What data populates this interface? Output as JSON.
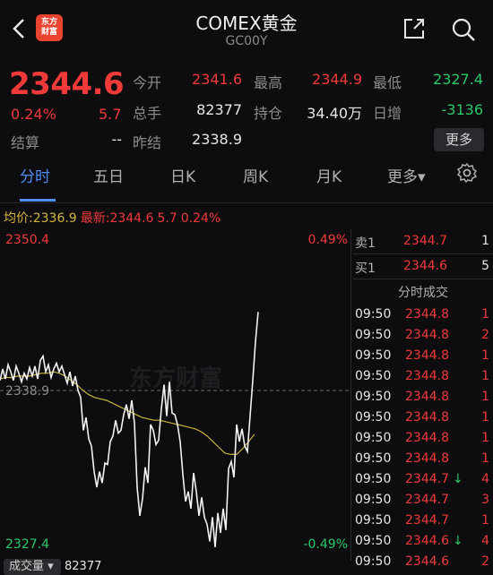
{
  "header": {
    "title": "COMEX黄金",
    "code": "GC00Y",
    "logo_text_1": "东方",
    "logo_text_2": "财富"
  },
  "quote": {
    "price": "2344.6",
    "change_pct": "0.24%",
    "change": "5.7",
    "open_label": "今开",
    "open": "2341.6",
    "high_label": "最高",
    "high": "2344.9",
    "low_label": "最低",
    "low": "2327.4",
    "volume_label": "总手",
    "volume": "82377",
    "oi_label": "持仓",
    "oi": "34.40万",
    "daily_inc_label": "日增",
    "daily_inc": "-3136",
    "settle_label": "结算",
    "settle": "--",
    "prev_settle_label": "昨结",
    "prev_settle": "2338.9",
    "more_button": "更多"
  },
  "tabs": [
    {
      "label": "分时",
      "active": true
    },
    {
      "label": "五日",
      "active": false
    },
    {
      "label": "日K",
      "active": false
    },
    {
      "label": "周K",
      "active": false
    },
    {
      "label": "月K",
      "active": false
    },
    {
      "label": "更多▾",
      "active": false
    }
  ],
  "info_line": {
    "avg_label": "均价:",
    "avg": "2336.9",
    "latest_label": "最新:",
    "latest": "2344.6",
    "change": "5.7",
    "change_pct": "0.24%"
  },
  "chart": {
    "top_price": "2350.4",
    "top_pct": "0.49%",
    "mid_price": "2338.9",
    "bottom_price": "2327.4",
    "bottom_pct": "-0.49%",
    "watermark": "东方财富"
  },
  "chart_data": {
    "type": "line",
    "ylim": [
      2327.4,
      2350.4
    ],
    "reference": 2338.9,
    "series": [
      {
        "values": [
          2339.8,
          2340.6,
          2339.9,
          2340.9,
          2340.4,
          2339.8,
          2340.8,
          2340.3,
          2339.7,
          2340.3,
          2339.9,
          2340.7,
          2340.1,
          2340.8,
          2339.9,
          2341.2,
          2341.5,
          2340.4,
          2340.9,
          2340.0,
          2340.6,
          2341.0,
          2340.4,
          2340.8,
          2340.2,
          2339.6,
          2340.4,
          2339.4,
          2340.1,
          2339.1,
          2338.6,
          2336.3,
          2337.2,
          2335.7,
          2335.2,
          2333.4,
          2332.3,
          2333.4,
          2332.6,
          2334.0,
          2333.9,
          2335.5,
          2335.9,
          2337.0,
          2336.1,
          2336.3,
          2337.4,
          2338.1,
          2337.1,
          2338.4,
          2336.8,
          2332.3,
          2330.3,
          2331.5,
          2333.7,
          2332.6,
          2336.7,
          2336.3,
          2335.3,
          2335.6,
          2337.8,
          2339.5,
          2337.3,
          2339.7,
          2337.5,
          2337.4,
          2336.7,
          2335.5,
          2333.2,
          2331.3,
          2332.0,
          2330.8,
          2333.3,
          2332.0,
          2330.3,
          2331.6,
          2330.2,
          2329.7,
          2328.5,
          2330.2,
          2328.1,
          2330.5,
          2329.1,
          2330.8,
          2329.3,
          2333.6,
          2334.1,
          2333.0,
          2336.7,
          2335.5,
          2336.4,
          2335.2,
          2334.8,
          2337.3,
          2339.8,
          2342.5,
          2344.6
        ]
      },
      {
        "values": [
          2339.9,
          2340.0,
          2340.0,
          2340.1,
          2340.1,
          2340.1,
          2340.2,
          2340.3,
          2340.3,
          2340.4,
          2340.3,
          2340.1,
          2339.8,
          2339.5,
          2339.1,
          2338.8,
          2338.6,
          2338.5,
          2338.4,
          2338.2,
          2338.0,
          2337.8,
          2337.6,
          2337.4,
          2337.2,
          2337.1,
          2337.0,
          2337.0,
          2336.9,
          2336.8,
          2336.7,
          2336.6,
          2336.5,
          2336.4,
          2336.2,
          2335.9,
          2335.5,
          2335.1,
          2334.7,
          2334.6,
          2334.6,
          2335.0,
          2335.5,
          2336.0
        ]
      }
    ]
  },
  "book": {
    "sell_label": "卖1",
    "sell_price": "2344.7",
    "sell_qty": "1",
    "buy_label": "买1",
    "buy_price": "2344.6",
    "buy_qty": "5",
    "trades_header": "分时成交"
  },
  "trades": [
    {
      "time": "09:50",
      "price": "2344.8",
      "qty": "1",
      "arrow": ""
    },
    {
      "time": "09:50",
      "price": "2344.8",
      "qty": "2",
      "arrow": ""
    },
    {
      "time": "09:50",
      "price": "2344.8",
      "qty": "1",
      "arrow": ""
    },
    {
      "time": "09:50",
      "price": "2344.8",
      "qty": "1",
      "arrow": ""
    },
    {
      "time": "09:50",
      "price": "2344.8",
      "qty": "1",
      "arrow": ""
    },
    {
      "time": "09:50",
      "price": "2344.8",
      "qty": "1",
      "arrow": ""
    },
    {
      "time": "09:50",
      "price": "2344.8",
      "qty": "1",
      "arrow": ""
    },
    {
      "time": "09:50",
      "price": "2344.8",
      "qty": "1",
      "arrow": ""
    },
    {
      "time": "09:50",
      "price": "2344.7",
      "qty": "4",
      "arrow": "↓"
    },
    {
      "time": "09:50",
      "price": "2344.7",
      "qty": "3",
      "arrow": ""
    },
    {
      "time": "09:50",
      "price": "2344.7",
      "qty": "1",
      "arrow": ""
    },
    {
      "time": "09:50",
      "price": "2344.6",
      "qty": "4",
      "arrow": "↓"
    },
    {
      "time": "09:50",
      "price": "2344.6",
      "qty": "2",
      "arrow": ""
    }
  ],
  "footer": {
    "volume_label": "成交量 ▾",
    "volume_value": "82377"
  },
  "colors": {
    "up": "#f03a3a",
    "down": "#2bc86a",
    "accent": "#4d8ff5",
    "avg_line": "#c9b33c"
  }
}
